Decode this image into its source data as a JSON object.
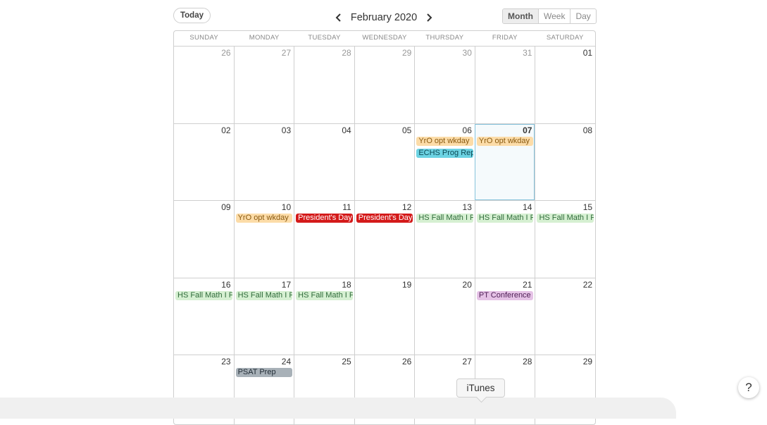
{
  "toolbar": {
    "today_label": "Today",
    "month_title": "February 2020",
    "views": [
      "Month",
      "Week",
      "Day"
    ],
    "active_view": "Month"
  },
  "days_of_week": [
    "SUNDAY",
    "MONDAY",
    "TUESDAY",
    "WEDNESDAY",
    "THURSDAY",
    "FRIDAY",
    "SATURDAY"
  ],
  "weeks": [
    [
      {
        "num": "26",
        "other": true
      },
      {
        "num": "27",
        "other": true
      },
      {
        "num": "28",
        "other": true
      },
      {
        "num": "29",
        "other": true
      },
      {
        "num": "30",
        "other": true
      },
      {
        "num": "31",
        "other": true
      },
      {
        "num": "01"
      }
    ],
    [
      {
        "num": "02"
      },
      {
        "num": "03"
      },
      {
        "num": "04"
      },
      {
        "num": "05"
      },
      {
        "num": "06",
        "events": [
          {
            "label": "YrO opt wkday",
            "bg": "#fcdca8",
            "fg": "#8a5a10"
          },
          {
            "label": "ECHS Prog Rep",
            "bg": "#6dd3e3",
            "fg": "#0b4a55"
          }
        ]
      },
      {
        "num": "07",
        "today": true,
        "events": [
          {
            "label": "YrO opt wkday",
            "bg": "#fcdca8",
            "fg": "#8a5a10"
          }
        ]
      },
      {
        "num": "08"
      }
    ],
    [
      {
        "num": "09"
      },
      {
        "num": "10",
        "events": [
          {
            "label": "YrO opt wkday",
            "bg": "#fcdca8",
            "fg": "#8a5a10"
          }
        ]
      },
      {
        "num": "11",
        "events": [
          {
            "label": "President's Day",
            "bg": "#d41a1a",
            "fg": "#ffffff"
          }
        ]
      },
      {
        "num": "12",
        "events": [
          {
            "label": "President's Day",
            "bg": "#d41a1a",
            "fg": "#ffffff"
          }
        ]
      },
      {
        "num": "13",
        "events": [
          {
            "label": "HS Fall Math I Pre",
            "bg": "#d6f0d2",
            "fg": "#2f6b3a"
          }
        ]
      },
      {
        "num": "14",
        "events": [
          {
            "label": "HS Fall Math I Pre",
            "bg": "#d6f0d2",
            "fg": "#2f6b3a"
          }
        ]
      },
      {
        "num": "15",
        "events": [
          {
            "label": "HS Fall Math I Pre",
            "bg": "#d6f0d2",
            "fg": "#2f6b3a"
          }
        ]
      }
    ],
    [
      {
        "num": "16",
        "events": [
          {
            "label": "HS Fall Math I Pre",
            "bg": "#d6f0d2",
            "fg": "#2f6b3a"
          }
        ]
      },
      {
        "num": "17",
        "events": [
          {
            "label": "HS Fall Math I Pre",
            "bg": "#d6f0d2",
            "fg": "#2f6b3a"
          }
        ]
      },
      {
        "num": "18",
        "events": [
          {
            "label": "HS Fall Math I Pre",
            "bg": "#d6f0d2",
            "fg": "#2f6b3a"
          }
        ]
      },
      {
        "num": "19"
      },
      {
        "num": "20"
      },
      {
        "num": "21",
        "events": [
          {
            "label": "PT Conference",
            "bg": "#e5c2e6",
            "fg": "#4e1f55"
          }
        ]
      },
      {
        "num": "22"
      }
    ],
    [
      {
        "num": "23"
      },
      {
        "num": "24",
        "events": [
          {
            "label": "PSAT Prep",
            "bg": "#a8b1b8",
            "fg": "#1f2a33"
          }
        ]
      },
      {
        "num": "25"
      },
      {
        "num": "26"
      },
      {
        "num": "27"
      },
      {
        "num": "28"
      },
      {
        "num": "29"
      }
    ]
  ],
  "tooltip": {
    "label": "iTunes"
  },
  "help": {
    "label": "?"
  }
}
